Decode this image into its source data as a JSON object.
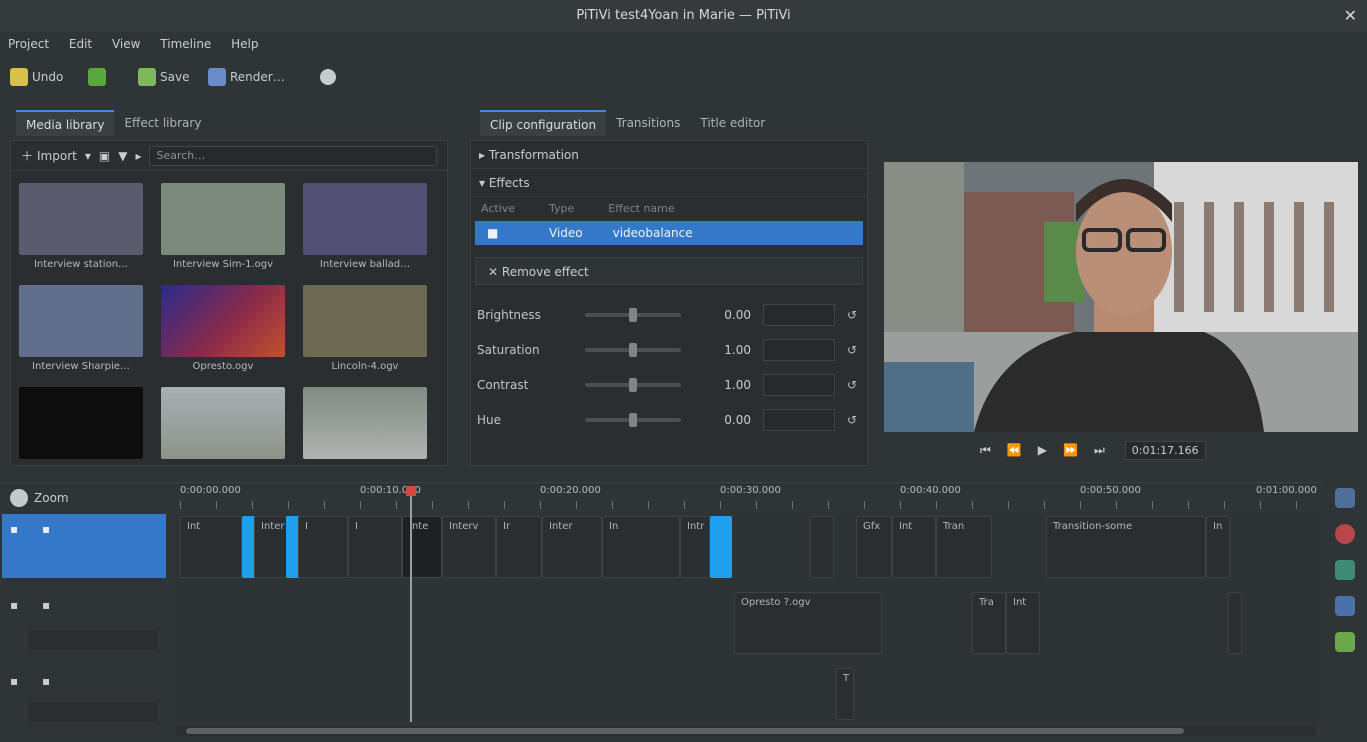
{
  "window": {
    "title": "PiTiVi test4Yoan in Marie — PiTiVi"
  },
  "menu": [
    "Project",
    "Edit",
    "View",
    "Timeline",
    "Help"
  ],
  "toolbar": {
    "undo": "Undo",
    "redo_icon": "redo-icon",
    "save": "Save",
    "render": "Render…",
    "colors": {
      "undo": "#d9c04a",
      "redo": "#5aa83c",
      "save": "#7fb85c",
      "render": "#6a8cc8",
      "gear": "#c6cbcb"
    }
  },
  "left_tabs": [
    "Media library",
    "Effect library"
  ],
  "media_toolbar": {
    "import": "Import",
    "search_placeholder": "Search…"
  },
  "media": [
    {
      "name": "Interview station…",
      "color": "#5b5a6e"
    },
    {
      "name": "Interview Sim-1.ogv",
      "color": "#7b8a7a"
    },
    {
      "name": "Interview ballad…",
      "color": "#524f74"
    },
    {
      "name": "Interview Sharpie…",
      "color": "#5f6f8c"
    },
    {
      "name": "Opresto.ogv",
      "color": "#8a2a4a"
    },
    {
      "name": "Lincoln-4.ogv",
      "color": "#6c6a52"
    },
    {
      "name": "",
      "color": "#0d0d0d"
    },
    {
      "name": "",
      "color": "#8c9488"
    },
    {
      "name": "",
      "color": "#9aa09a"
    }
  ],
  "middle_tabs": [
    "Clip configuration",
    "Transitions",
    "Title editor"
  ],
  "clip_config": {
    "transformation": "Transformation",
    "effects": "Effects",
    "columns": [
      "Active",
      "Type",
      "Effect name"
    ],
    "effect_row": {
      "type": "Video",
      "name": "videobalance"
    },
    "remove_effect": "Remove effect",
    "params": [
      {
        "name": "Brightness",
        "value": "0.00",
        "pos": 0.5
      },
      {
        "name": "Saturation",
        "value": "1.00",
        "pos": 0.5
      },
      {
        "name": "Contrast",
        "value": "1.00",
        "pos": 0.5
      },
      {
        "name": "Hue",
        "value": "0.00",
        "pos": 0.5
      }
    ]
  },
  "transport": {
    "timecode": "0:01:17.166"
  },
  "timeline": {
    "zoom_label": "Zoom",
    "ruler": [
      "0:00:00.000",
      "0:00:10.000",
      "0:00:20.000",
      "0:00:30.000",
      "0:00:40.000",
      "0:00:50.000",
      "0:01:00.000"
    ],
    "clips_track1": [
      "Int",
      "Inter",
      "I",
      "I",
      "Inte",
      "Interv",
      "Ir",
      "Inter",
      "In",
      "Intr",
      "Gfx",
      "Int",
      "Tran",
      "Transition-some",
      "In"
    ],
    "clips_track2": [
      "Opresto ?.ogv",
      "Tra",
      "Int"
    ],
    "clips_track3": [
      "T"
    ]
  }
}
